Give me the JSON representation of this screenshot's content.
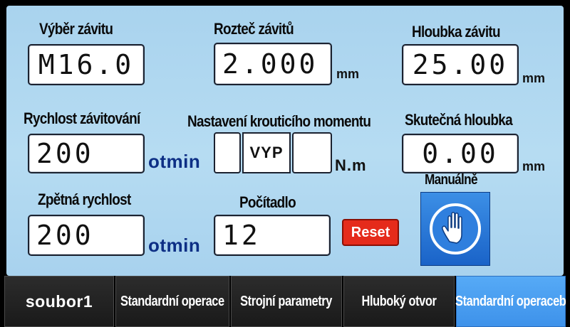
{
  "thread_select": {
    "label": "Výběr závitu",
    "value": "M16.0"
  },
  "thread_pitch": {
    "label": "Rozteč závitů",
    "value": "2.000",
    "unit": "mm"
  },
  "thread_depth": {
    "label": "Hloubka závitu",
    "value": "25.00",
    "unit": "mm"
  },
  "tapping_speed": {
    "label": "Rychlost závitování",
    "value": "200",
    "unit": "otmin"
  },
  "torque": {
    "label": "Nastavení krouticího momentu",
    "value": "VYP",
    "unit": "N.m"
  },
  "actual_depth": {
    "label": "Skutečná hloubka",
    "value": "0.00",
    "unit": "mm"
  },
  "return_speed": {
    "label": "Zpětná rychlost",
    "value": "200",
    "unit": "otmin"
  },
  "counter": {
    "label": "Počítadlo",
    "value": "12",
    "reset_label": "Reset"
  },
  "manual": {
    "label": "Manuálně",
    "icon": "hand-stop-icon"
  },
  "tabs": [
    {
      "label": "soubor1",
      "active": false
    },
    {
      "label": "Standardní operace",
      "active": false
    },
    {
      "label": "Strojní parametry",
      "active": false
    },
    {
      "label": "Hluboký otvor",
      "active": false
    },
    {
      "label": "Standardní operaceb",
      "active": true
    }
  ],
  "colors": {
    "panel": "#b0d8f0",
    "unit_blue": "#0d2f85",
    "reset_red": "#e52b1b",
    "manual_blue": "#2a78d8",
    "active_tab": "#4a9ef0"
  }
}
